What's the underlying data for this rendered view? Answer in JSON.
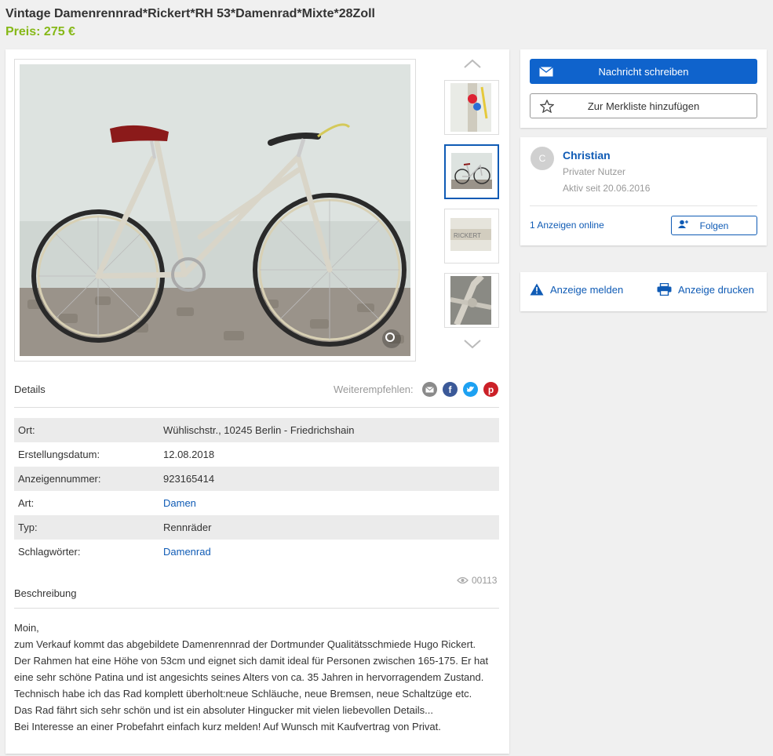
{
  "listing": {
    "title": "Vintage Damenrennrad*Rickert*RH 53*Damenrad*Mixte*28Zoll",
    "price": "Preis: 275 €"
  },
  "gallery": {
    "thumbnail_count": 4,
    "active_index": 1
  },
  "details": {
    "heading": "Details",
    "share_label": "Weiterempfehlen:",
    "share_icons": [
      "email-icon",
      "facebook-icon",
      "twitter-icon",
      "pinterest-icon"
    ],
    "rows": [
      {
        "key": "Ort:",
        "value": "Wühlischstr., 10245 Berlin - Friedrichshain",
        "link": false
      },
      {
        "key": "Erstellungsdatum:",
        "value": "12.08.2018",
        "link": false
      },
      {
        "key": "Anzeigennummer:",
        "value": "923165414",
        "link": false
      },
      {
        "key": "Art:",
        "value": "Damen",
        "link": true
      },
      {
        "key": "Typ:",
        "value": "Rennräder",
        "link": false
      },
      {
        "key": "Schlagwörter:",
        "value": "Damenrad",
        "link": true
      }
    ],
    "views": "00113"
  },
  "description": {
    "heading": "Beschreibung",
    "lines": [
      "Moin,",
      "zum Verkauf kommt das abgebildete Damenrennrad der Dortmunder Qualitätsschmiede Hugo Rickert.",
      "Der Rahmen hat eine Höhe von 53cm und eignet sich damit ideal für Personen zwischen 165-175. Er hat",
      "eine sehr schöne Patina und ist angesichts seines Alters von ca. 35 Jahren in hervorragendem Zustand.",
      "Technisch habe ich das Rad komplett überholt:neue Schläuche, neue Bremsen, neue Schaltzüge etc.",
      "Das Rad fährt sich sehr schön und ist ein absoluter Hingucker mit vielen liebevollen Details...",
      "Bei Interesse an einer Probefahrt einfach kurz melden! Auf Wunsch mit Kaufvertrag von Privat."
    ]
  },
  "actions": {
    "message_label": "Nachricht schreiben",
    "watchlist_label": "Zur Merkliste hinzufügen"
  },
  "seller": {
    "initial": "C",
    "name": "Christian",
    "type": "Privater Nutzer",
    "active_since": "Aktiv seit 20.06.2016",
    "ads_online": "1 Anzeigen online",
    "follow_label": "Folgen"
  },
  "report": {
    "report_label": "Anzeige melden",
    "print_label": "Anzeige drucken"
  },
  "colors": {
    "primary": "#0f63cc",
    "link": "#0f5bb5",
    "price": "#86b817"
  }
}
